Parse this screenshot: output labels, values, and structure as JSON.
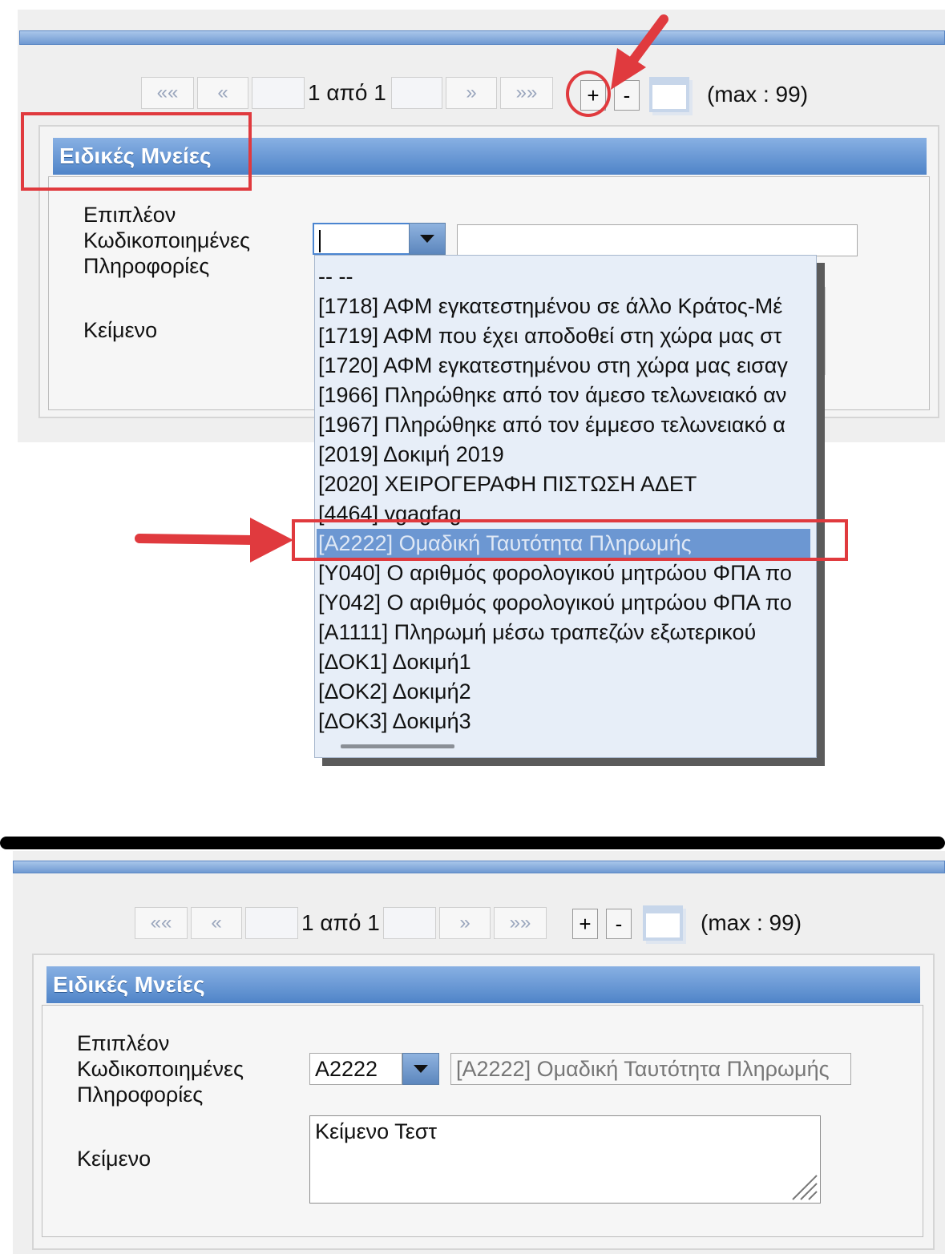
{
  "top": {
    "pager": {
      "first": "««",
      "prev": "«",
      "info": "1 από 1",
      "next": "»",
      "last": "»»",
      "add": "+",
      "remove": "-",
      "max": "(max : 99)"
    },
    "section_title": "Ειδικές Μνείες",
    "field_label_line1": "Επιπλέον",
    "field_label_line2": "Κωδικοποιημένες",
    "field_label_line3": "Πληροφορίες",
    "code_value": "",
    "description_value": "",
    "text_label": "Κείμενο",
    "dropdown_options": [
      "-- --",
      "[1718] ΑΦΜ εγκατεστημένου σε άλλο Κράτος-Μέ",
      "[1719] ΑΦΜ που έχει αποδοθεί στη χώρα μας στ",
      "[1720] ΑΦΜ εγκατεστημένου στη χώρα μας εισαγ",
      "[1966] Πληρώθηκε από τον άμεσο τελωνειακό αν",
      "[1967] Πληρώθηκε από τον έμμεσο τελωνειακό α",
      "[2019] Δοκιμή 2019",
      "[2020] ΧΕΙΡΟΓΕΡΑΦΗ ΠΙΣΤΩΣΗ ΑΔΕΤ",
      "[4464] vgagfag",
      "[A2222] Ομαδική Ταυτότητα Πληρωμής",
      "[Y040] Ο αριθμός φορολογικού μητρώου ΦΠΑ πο",
      "[Y042] Ο αριθμός φορολογικού μητρώου ΦΠΑ πο",
      "[A1111] Πληρωμή μέσω τραπεζών εξωτερικού",
      "[ΔΟΚ1] Δοκιμή1",
      "[ΔΟΚ2] Δοκιμή2",
      "[ΔΟΚ3] Δοκιμή3"
    ],
    "selected_index": 9
  },
  "bottom": {
    "pager": {
      "first": "««",
      "prev": "«",
      "info": "1 από 1",
      "next": "»",
      "last": "»»",
      "add": "+",
      "remove": "-",
      "max": "(max : 99)"
    },
    "section_title": "Ειδικές Μνείες",
    "field_label_line1": "Επιπλέον",
    "field_label_line2": "Κωδικοποιημένες",
    "field_label_line3": "Πληροφορίες",
    "code_value": "A2222",
    "description_value": "[A2222] Ομαδική Ταυτότητα Πληρωμής",
    "text_label": "Κείμενο",
    "text_value": "Κείμενο Τεστ"
  },
  "colors": {
    "annotation_red": "#e03a3e",
    "header_blue": "#4f84c8",
    "selected_option": "#6c97d2"
  }
}
